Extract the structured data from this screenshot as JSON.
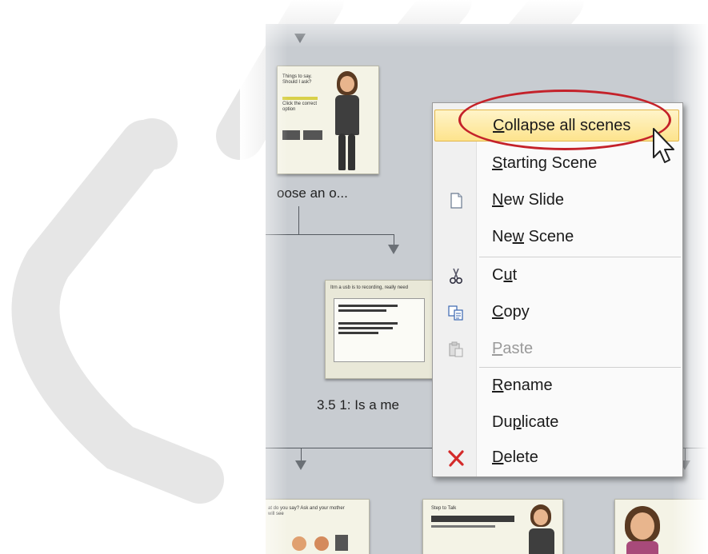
{
  "scenes": {
    "top_label": "oose an o...",
    "mid_label": "3.5 1: Is a me"
  },
  "context_menu": {
    "items": [
      {
        "label": "Collapse all scenes",
        "accel": "C",
        "highlighted": true
      },
      {
        "label": "Starting Scene",
        "accel": "S"
      },
      {
        "label": "New Slide",
        "accel": "N",
        "icon": "new-slide-icon"
      },
      {
        "label": "New Scene",
        "accel": "w"
      },
      {
        "label": "Cut",
        "accel": "u",
        "icon": "scissors-icon"
      },
      {
        "label": "Copy",
        "accel": "C",
        "icon": "copy-icon"
      },
      {
        "label": "Paste",
        "accel": "P",
        "icon": "paste-icon",
        "disabled": true
      },
      {
        "label": "Rename",
        "accel": "R"
      },
      {
        "label": "Duplicate",
        "accel": "p"
      },
      {
        "label": "Delete",
        "accel": "D",
        "icon": "delete-x-icon"
      }
    ]
  },
  "colors": {
    "highlight_ring": "#c4222a",
    "menu_highlight": "#fde38c",
    "delete_icon": "#d42a2a"
  }
}
